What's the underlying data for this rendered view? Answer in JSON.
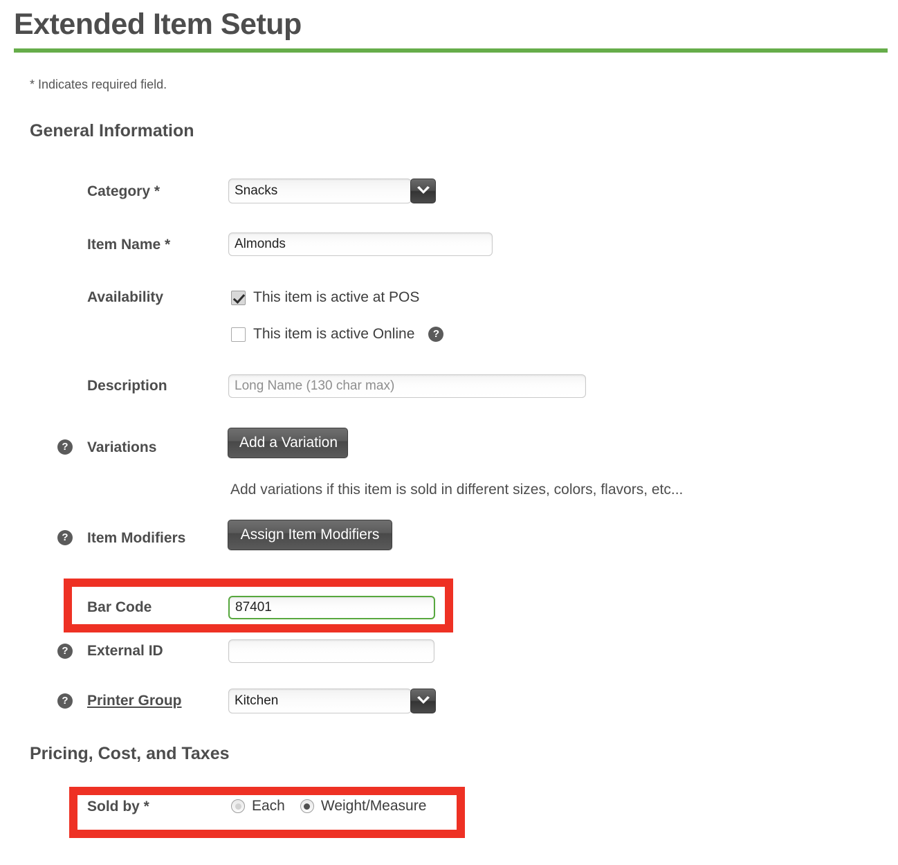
{
  "page": {
    "title": "Extended Item Setup",
    "required_note": "* Indicates required field.",
    "accent_color": "#66ad4a",
    "highlight_color": "#ee3124"
  },
  "sections": {
    "general": {
      "heading": "General Information",
      "category": {
        "label": "Category *",
        "value": "Snacks",
        "icon": "chevron-down-icon"
      },
      "item_name": {
        "label": "Item Name *",
        "value": "Almonds"
      },
      "availability": {
        "label": "Availability",
        "pos": {
          "label": "This item is active at POS",
          "checked": true
        },
        "online": {
          "label": "This item is active Online",
          "checked": false,
          "help_icon": "help-icon"
        }
      },
      "description": {
        "label": "Description",
        "value": "",
        "placeholder": "Long Name (130 char max)"
      },
      "variations": {
        "label": "Variations",
        "help_icon": "help-icon",
        "button_label": "Add a Variation",
        "helper_text": "Add variations if this item is sold in different sizes, colors, flavors, etc..."
      },
      "item_modifiers": {
        "label": "Item Modifiers",
        "help_icon": "help-icon",
        "button_label": "Assign Item Modifiers"
      },
      "bar_code": {
        "label": "Bar Code",
        "value": "87401",
        "focused": true,
        "highlighted": true
      },
      "external_id": {
        "label": "External ID",
        "value": "",
        "help_icon": "help-icon"
      },
      "printer_group": {
        "label": "Printer Group",
        "value": "Kitchen",
        "help_icon": "help-icon",
        "icon": "chevron-down-icon",
        "is_link": true
      }
    },
    "pricing": {
      "heading": "Pricing, Cost, and Taxes",
      "sold_by": {
        "label": "Sold by *",
        "highlighted": true,
        "options": [
          {
            "label": "Each",
            "selected": false
          },
          {
            "label": "Weight/Measure",
            "selected": true
          }
        ]
      }
    }
  }
}
